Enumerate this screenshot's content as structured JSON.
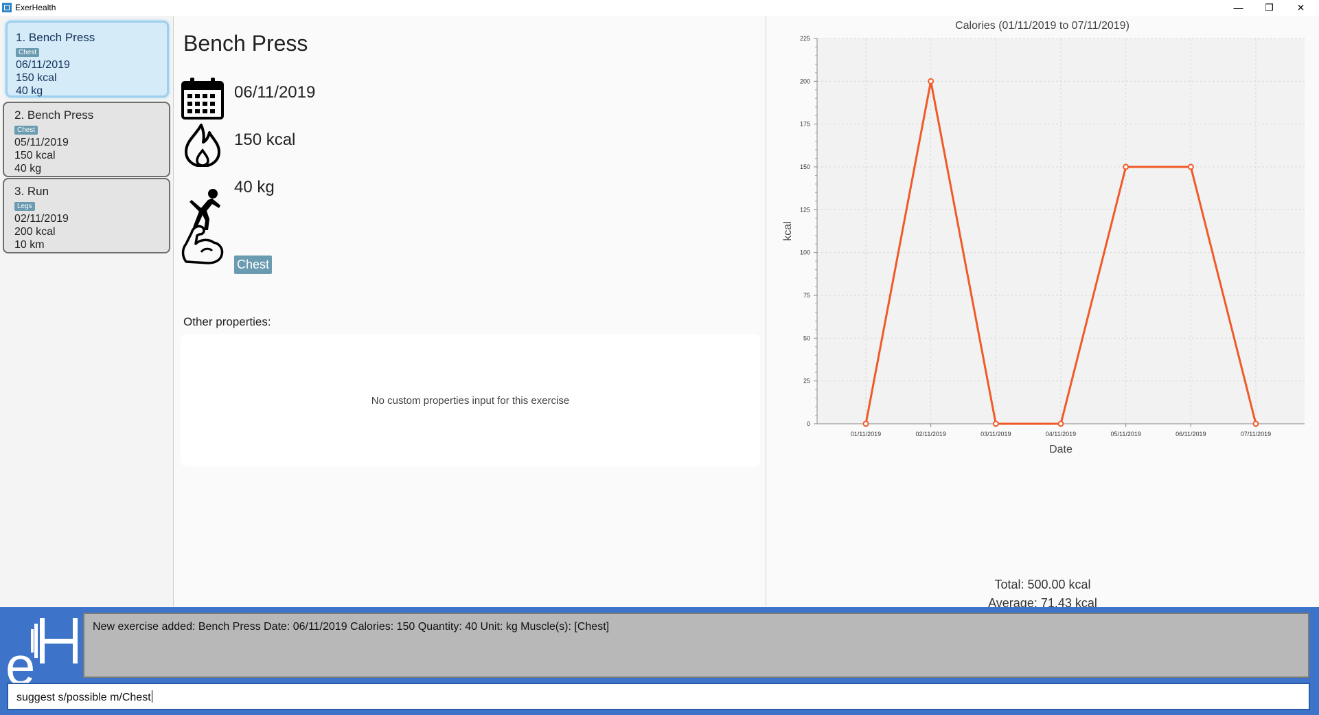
{
  "window": {
    "title": "ExerHealth",
    "minimize": "—",
    "restore": "❐",
    "close": "✕"
  },
  "exercise_list": [
    {
      "index_title": "1.  Bench Press",
      "muscle": "Chest",
      "date": "06/11/2019",
      "calories": "150 kcal",
      "quantity": "40 kg"
    },
    {
      "index_title": "2.  Bench Press",
      "muscle": "Chest",
      "date": "05/11/2019",
      "calories": "150 kcal",
      "quantity": "40 kg"
    },
    {
      "index_title": "3.  Run",
      "muscle": "Legs",
      "date": "02/11/2019",
      "calories": "200 kcal",
      "quantity": "10 km"
    }
  ],
  "detail": {
    "title": "Bench Press",
    "date": "06/11/2019",
    "calories": "150 kcal",
    "quantity": "40 kg",
    "muscle": "Chest",
    "other_label": "Other properties:",
    "no_props": "No custom properties input for this exercise",
    "icons": [
      "calendar-icon",
      "flame-icon",
      "stretching-person-icon",
      "flexed-bicep-icon"
    ]
  },
  "chart_data": {
    "type": "line",
    "title": "Calories (01/11/2019 to 07/11/2019)",
    "xlabel": "Date",
    "ylabel": "kcal",
    "categories": [
      "01/11/2019",
      "02/11/2019",
      "03/11/2019",
      "04/11/2019",
      "05/11/2019",
      "06/11/2019",
      "07/11/2019"
    ],
    "values": [
      0,
      200,
      0,
      0,
      150,
      150,
      0
    ],
    "ylim": [
      0,
      225
    ],
    "yticks": [
      0,
      25,
      50,
      75,
      100,
      125,
      150,
      175,
      200,
      225
    ],
    "grid": true,
    "legend": "none",
    "line_color": "#f05a28"
  },
  "stats": {
    "total": "Total: 500.00 kcal",
    "average": "Average: 71.43 kcal"
  },
  "result_display": "New exercise added: Bench Press Date: 06/11/2019 Calories: 150 Quantity: 40 Unit: kg Muscle(s): [Chest]",
  "command_box": {
    "value": "suggest s/possible m/Chest"
  },
  "colors": {
    "accent": "#3d74c9",
    "tag": "#6a9bb0",
    "selected": "#d5ebf7"
  }
}
